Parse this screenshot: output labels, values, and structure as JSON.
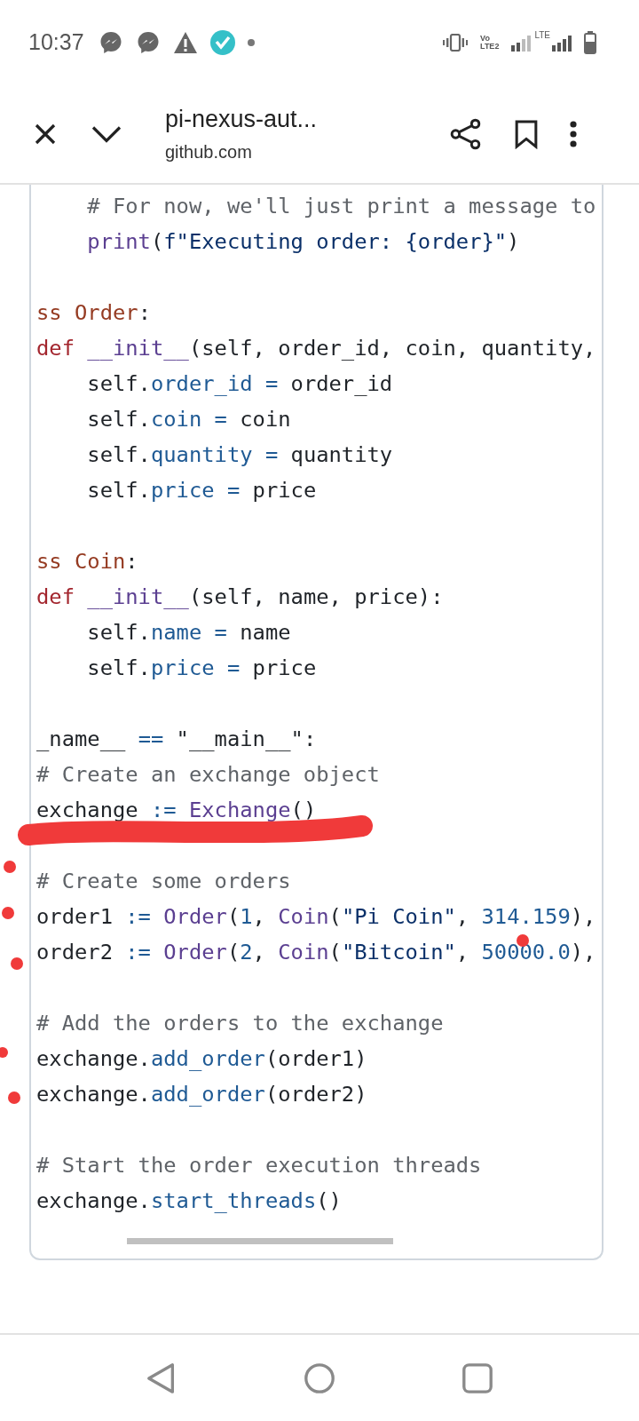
{
  "status_bar": {
    "time": "10:37",
    "volte_top": "Vo",
    "volte_bottom": "LTE2",
    "network": "LTE"
  },
  "toolbar": {
    "title": "pi-nexus-aut...",
    "subtitle": "github.com"
  },
  "code": {
    "lines": [
      {
        "kind": "code",
        "tokens": [
          {
            "t": "    # For now, we'll just print a message to",
            "kind": "comment"
          }
        ]
      },
      {
        "kind": "code",
        "tokens": [
          {
            "t": "    print",
            "kind": "func"
          },
          {
            "t": "(",
            "kind": "plain"
          },
          {
            "t": "f\"Executing order: {order}\"",
            "kind": "string"
          },
          {
            "t": ")",
            "kind": "plain"
          }
        ]
      },
      {
        "kind": "blank"
      },
      {
        "kind": "code",
        "tokens": [
          {
            "t": "ss Order",
            "kind": "classname"
          },
          {
            "t": ":",
            "kind": "plain"
          }
        ]
      },
      {
        "kind": "code",
        "tokens": [
          {
            "t": "def ",
            "kind": "keyword"
          },
          {
            "t": "__init__",
            "kind": "func"
          },
          {
            "t": "(self, order_id, coin, quantity,",
            "kind": "plain"
          }
        ]
      },
      {
        "kind": "code",
        "tokens": [
          {
            "t": "    self.",
            "kind": "plain"
          },
          {
            "t": "order_id",
            "kind": "attr"
          },
          {
            "t": " = ",
            "kind": "op"
          },
          {
            "t": "order_id",
            "kind": "plain"
          }
        ]
      },
      {
        "kind": "code",
        "tokens": [
          {
            "t": "    self.",
            "kind": "plain"
          },
          {
            "t": "coin",
            "kind": "attr"
          },
          {
            "t": " = ",
            "kind": "op"
          },
          {
            "t": "coin",
            "kind": "plain"
          }
        ]
      },
      {
        "kind": "code",
        "tokens": [
          {
            "t": "    self.",
            "kind": "plain"
          },
          {
            "t": "quantity",
            "kind": "attr"
          },
          {
            "t": " = ",
            "kind": "op"
          },
          {
            "t": "quantity",
            "kind": "plain"
          }
        ]
      },
      {
        "kind": "code",
        "tokens": [
          {
            "t": "    self.",
            "kind": "plain"
          },
          {
            "t": "price",
            "kind": "attr"
          },
          {
            "t": " = ",
            "kind": "op"
          },
          {
            "t": "price",
            "kind": "plain"
          }
        ]
      },
      {
        "kind": "blank"
      },
      {
        "kind": "code",
        "tokens": [
          {
            "t": "ss Coin",
            "kind": "classname"
          },
          {
            "t": ":",
            "kind": "plain"
          }
        ]
      },
      {
        "kind": "code",
        "tokens": [
          {
            "t": "def ",
            "kind": "keyword"
          },
          {
            "t": "__init__",
            "kind": "func"
          },
          {
            "t": "(self, name, price):",
            "kind": "plain"
          }
        ]
      },
      {
        "kind": "code",
        "tokens": [
          {
            "t": "    self.",
            "kind": "plain"
          },
          {
            "t": "name",
            "kind": "attr"
          },
          {
            "t": " = ",
            "kind": "op"
          },
          {
            "t": "name",
            "kind": "plain"
          }
        ]
      },
      {
        "kind": "code",
        "tokens": [
          {
            "t": "    self.",
            "kind": "plain"
          },
          {
            "t": "price",
            "kind": "attr"
          },
          {
            "t": " = ",
            "kind": "op"
          },
          {
            "t": "price",
            "kind": "plain"
          }
        ]
      },
      {
        "kind": "blank"
      },
      {
        "kind": "code",
        "tokens": [
          {
            "t": "_name__ ",
            "kind": "plain"
          },
          {
            "t": "==",
            "kind": "op"
          },
          {
            "t": " \"__main__\":",
            "kind": "plain"
          }
        ]
      },
      {
        "kind": "code",
        "tokens": [
          {
            "t": "# Create an exchange object",
            "kind": "comment"
          }
        ]
      },
      {
        "kind": "code",
        "tokens": [
          {
            "t": "exchange ",
            "kind": "plain"
          },
          {
            "t": ":= ",
            "kind": "op"
          },
          {
            "t": "Exchange",
            "kind": "func"
          },
          {
            "t": "()",
            "kind": "plain"
          }
        ]
      },
      {
        "kind": "blank"
      },
      {
        "kind": "code",
        "tokens": [
          {
            "t": "# Create some orders",
            "kind": "comment"
          }
        ]
      },
      {
        "kind": "code",
        "tokens": [
          {
            "t": "order1 ",
            "kind": "plain"
          },
          {
            "t": ":= ",
            "kind": "op"
          },
          {
            "t": "Order",
            "kind": "func"
          },
          {
            "t": "(",
            "kind": "plain"
          },
          {
            "t": "1",
            "kind": "number"
          },
          {
            "t": ", ",
            "kind": "plain"
          },
          {
            "t": "Coin",
            "kind": "func"
          },
          {
            "t": "(",
            "kind": "plain"
          },
          {
            "t": "\"Pi Coin\"",
            "kind": "string"
          },
          {
            "t": ", ",
            "kind": "plain"
          },
          {
            "t": "314.159",
            "kind": "number"
          },
          {
            "t": "),",
            "kind": "plain"
          }
        ]
      },
      {
        "kind": "code",
        "tokens": [
          {
            "t": "order2 ",
            "kind": "plain"
          },
          {
            "t": ":= ",
            "kind": "op"
          },
          {
            "t": "Order",
            "kind": "func"
          },
          {
            "t": "(",
            "kind": "plain"
          },
          {
            "t": "2",
            "kind": "number"
          },
          {
            "t": ", ",
            "kind": "plain"
          },
          {
            "t": "Coin",
            "kind": "func"
          },
          {
            "t": "(",
            "kind": "plain"
          },
          {
            "t": "\"Bitcoin\"",
            "kind": "string"
          },
          {
            "t": ", ",
            "kind": "plain"
          },
          {
            "t": "50000.0",
            "kind": "number"
          },
          {
            "t": "),",
            "kind": "plain"
          }
        ]
      },
      {
        "kind": "blank"
      },
      {
        "kind": "code",
        "tokens": [
          {
            "t": "# Add the orders to the exchange",
            "kind": "comment"
          }
        ]
      },
      {
        "kind": "code",
        "tokens": [
          {
            "t": "exchange.",
            "kind": "plain"
          },
          {
            "t": "add_order",
            "kind": "attr"
          },
          {
            "t": "(order1)",
            "kind": "plain"
          }
        ]
      },
      {
        "kind": "code",
        "tokens": [
          {
            "t": "exchange.",
            "kind": "plain"
          },
          {
            "t": "add_order",
            "kind": "attr"
          },
          {
            "t": "(order2)",
            "kind": "plain"
          }
        ]
      },
      {
        "kind": "blank"
      },
      {
        "kind": "code",
        "tokens": [
          {
            "t": "# Start the order execution threads",
            "kind": "comment"
          }
        ]
      },
      {
        "kind": "code",
        "tokens": [
          {
            "t": "exchange.",
            "kind": "plain"
          },
          {
            "t": "start_threads",
            "kind": "attr"
          },
          {
            "t": "()",
            "kind": "plain"
          }
        ]
      }
    ]
  }
}
